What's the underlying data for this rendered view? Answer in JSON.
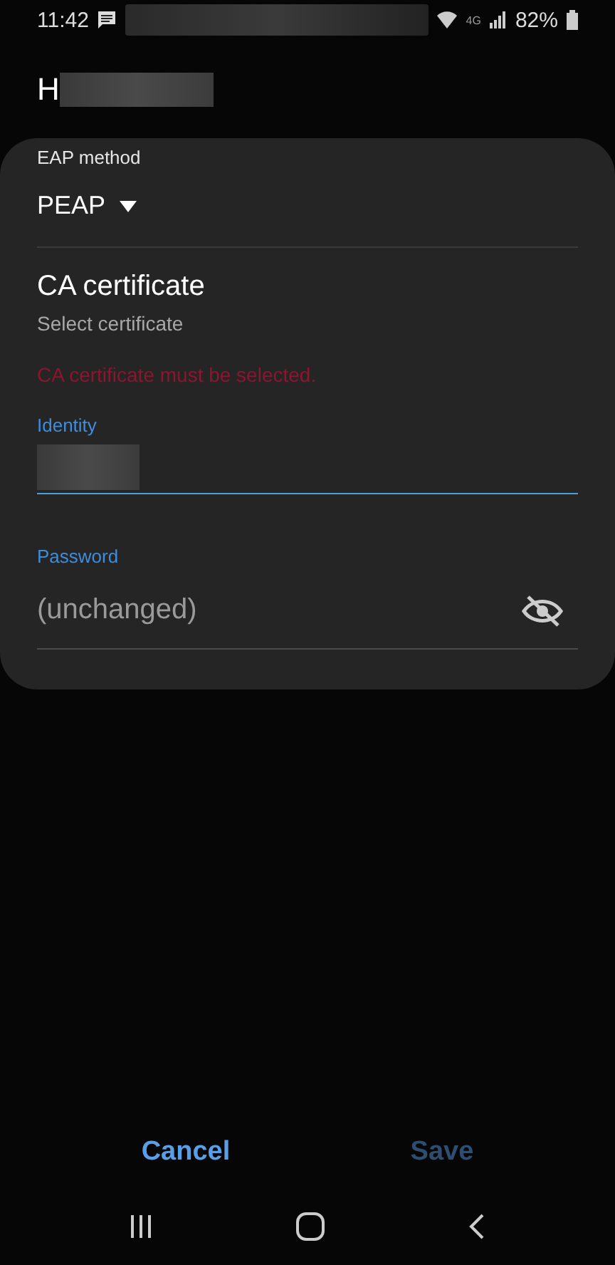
{
  "status_bar": {
    "time": "11:42",
    "network": "4G",
    "battery": "82%"
  },
  "title": "H",
  "eap_method": {
    "label": "EAP method",
    "value": "PEAP"
  },
  "ca_certificate": {
    "title": "CA certificate",
    "subtitle": "Select certificate",
    "error": "CA certificate must be selected."
  },
  "identity": {
    "label": "Identity",
    "focused": true
  },
  "password": {
    "label": "Password",
    "placeholder": "(unchanged)",
    "focused": false,
    "visible": false
  },
  "buttons": [
    {
      "label": "Cancel",
      "disabled": false
    },
    {
      "label": "Save",
      "disabled": true
    }
  ]
}
